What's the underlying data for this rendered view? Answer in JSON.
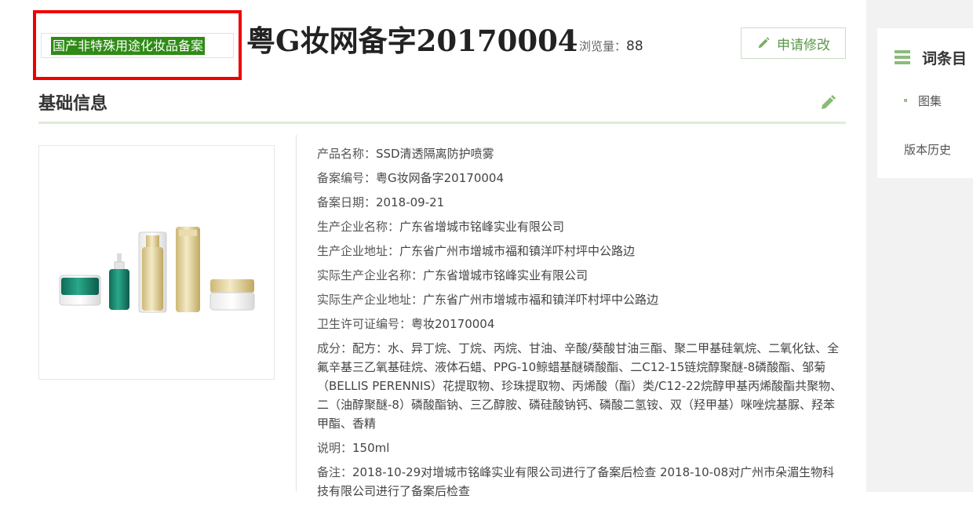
{
  "header": {
    "category": "国产非特殊用途化妆品备案",
    "title": "粤G妆网备字20170004",
    "view_label": "浏览量：",
    "view_count": "88",
    "edit_request": "申请修改"
  },
  "section": {
    "title": "基础信息"
  },
  "info": [
    {
      "label": "产品名称：",
      "value": "SSD清透隔离防护喷雾"
    },
    {
      "label": "备案编号：",
      "value": "粤G妆网备字20170004"
    },
    {
      "label": "备案日期：",
      "value": "2018-09-21"
    },
    {
      "label": "生产企业名称：",
      "value": "广东省增城市铭峰实业有限公司"
    },
    {
      "label": "生产企业地址：",
      "value": "广东省广州市增城市福和镇洋吓村坪中公路边"
    },
    {
      "label": "实际生产企业名称：",
      "value": "广东省增城市铭峰实业有限公司"
    },
    {
      "label": "实际生产企业地址：",
      "value": "广东省广州市增城市福和镇洋吓村坪中公路边"
    },
    {
      "label": "卫生许可证编号：",
      "value": "粤妆20170004"
    },
    {
      "label": "成分：",
      "value": "配方：水、异丁烷、丁烷、丙烷、甘油、辛酸/葵酸甘油三酯、聚二甲基硅氧烷、二氧化钛、全氟辛基三乙氧基硅烷、液体石蜡、PPG-10鲸蜡基醚磷酸酯、二C12-15链烷醇聚醚-8磷酸酯、邹菊（BELLIS PERENNIS）花提取物、珍珠提取物、丙烯酸（酯）类/C12-22烷醇甲基丙烯酸酯共聚物、二（油醇聚醚-8）磷酸酯钠、三乙醇胺、磷硅酸钠钙、磷酸二氢铵、双（羟甲基）咪唑烷基脲、羟苯甲酯、香精"
    },
    {
      "label": "说明：",
      "value": "150ml"
    },
    {
      "label": "备注：",
      "value": "2018-10-29对增城市铭峰实业有限公司进行了备案后检查 2018-10-08对广州市朵湄生物科技有限公司进行了备案后检查"
    }
  ],
  "sidebar": {
    "title": "词条目",
    "items": [
      "图集"
    ],
    "history": "版本历史"
  },
  "colors": {
    "accent_green": "#2e8b14",
    "highlight_red": "#ee0000",
    "button_green": "#5a9a4a"
  }
}
